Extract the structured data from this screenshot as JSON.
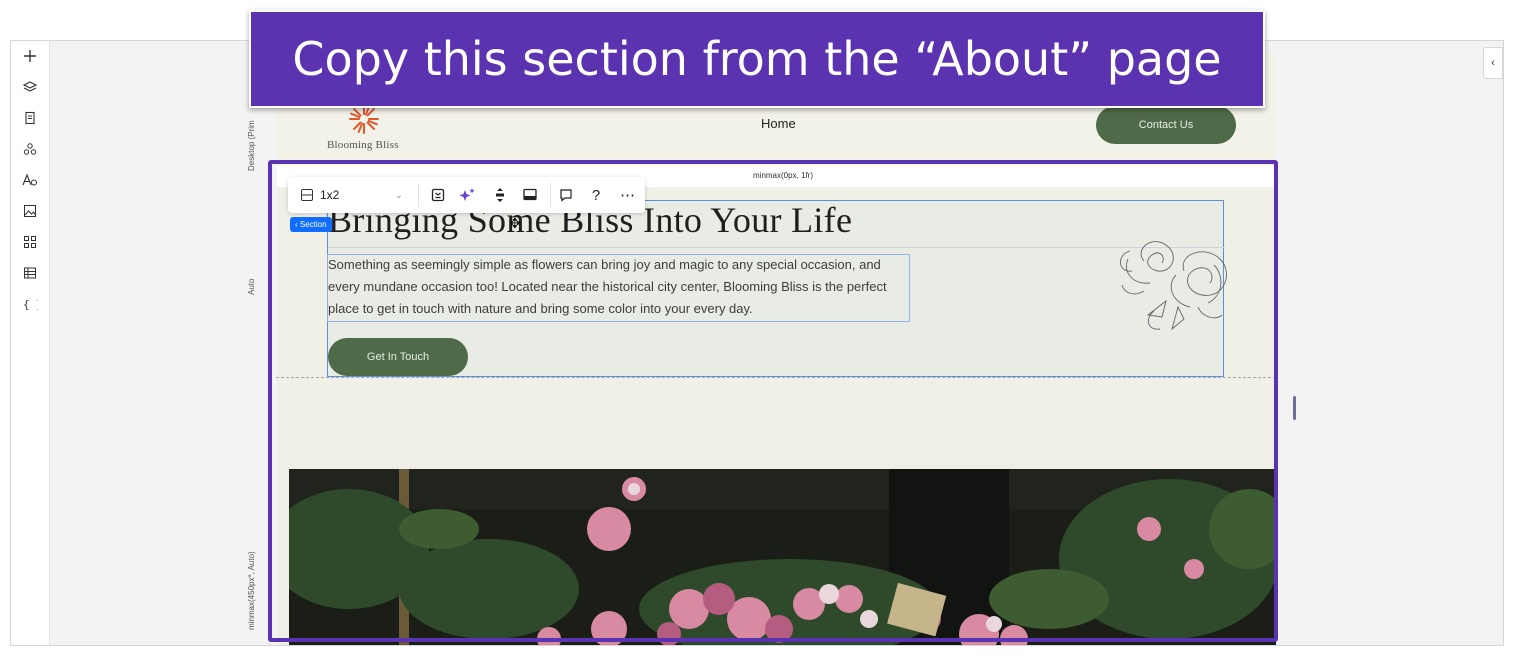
{
  "banner": {
    "text": "Copy this section from the “About” page"
  },
  "left_rail": {
    "icons": [
      "add-icon",
      "layers-icon",
      "pages-icon",
      "components-icon",
      "typography-icon",
      "media-icon",
      "apps-icon",
      "table-icon",
      "code-icon"
    ]
  },
  "ruler": {
    "device_label": "Desktop (Prim",
    "row1_label": "Auto",
    "row2_label": "minmax(450px*, Auto)"
  },
  "grid_bar": {
    "label": "minmax(0px, 1fr)"
  },
  "toolbar": {
    "layout_value": "1x2",
    "items": [
      "grid-layout-icon",
      "fit-icon",
      "ai-sparkle-icon",
      "stack-icon",
      "animation-icon",
      "comment-icon",
      "help-icon",
      "more-icon"
    ]
  },
  "section_badge": {
    "label": "‹ Section"
  },
  "site": {
    "logo_text": "Blooming Bliss",
    "nav_home": "Home",
    "contact_label": "Contact Us",
    "headline": "Bringing Some Bliss Into Your Life",
    "body": "Something as seemingly simple as flowers can bring joy and magic to any special occasion, and every mundane occasion too! Located near the historical city center, Blooming Bliss is the perfect place to get in touch with nature and bring some color into your every day.",
    "cta_label": "Get In Touch"
  },
  "colors": {
    "accent_purple": "#5b32b0",
    "brand_green": "#4f6a48",
    "selection_blue": "#116dff"
  }
}
